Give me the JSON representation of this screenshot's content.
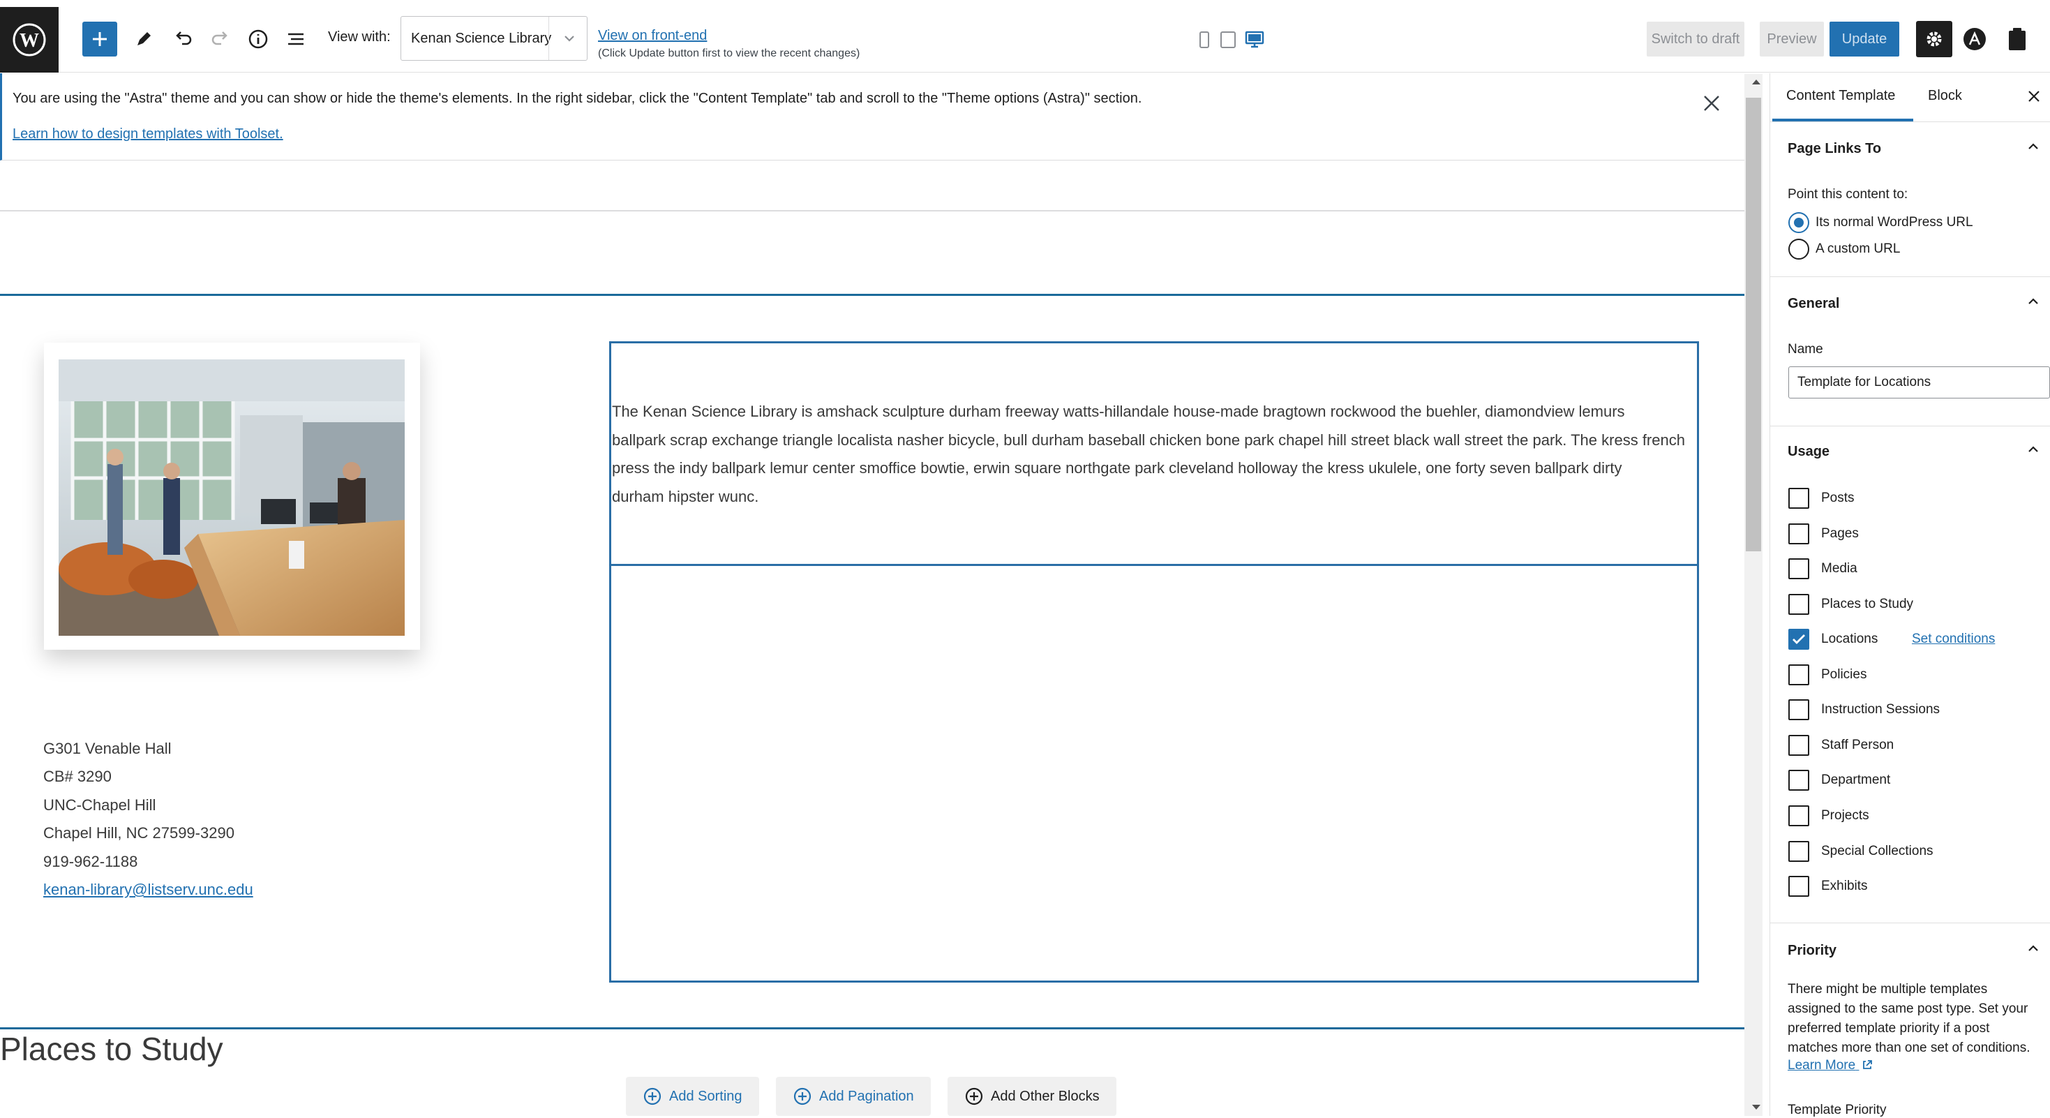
{
  "toolbar": {
    "view_with_label": "View with:",
    "view_with_value": "Kenan Science Library",
    "view_frontend_link": "View on front-end",
    "view_frontend_note": "(Click Update button first to view the recent changes)",
    "switch_to_draft": "Switch to draft",
    "preview": "Preview",
    "update": "Update"
  },
  "notice": {
    "text": "You are using the \"Astra\" theme and you can show or hide the theme's elements. In the right sidebar, click the \"Content Template\" tab and scroll to the \"Theme options (Astra)\" section.",
    "link": "Learn how to design templates with Toolset."
  },
  "content": {
    "address_lines": [
      "G301 Venable Hall",
      "CB# 3290",
      "UNC-Chapel Hill",
      "Chapel Hill, NC 27599-3290",
      "919-962-1188"
    ],
    "email": "kenan-library@listserv.unc.edu",
    "description_lines": [
      "The Kenan Science Library is amshack sculpture durham freeway watts-hillandale house-made bragtown rockwood the buehler, diamondview lemurs",
      "ballpark scrap exchange triangle localista nasher bicycle, bull durham baseball chicken bone park chapel hill street black wall street the park. The kress french",
      "press the indy ballpark lemur center smoffice bowtie, erwin square northgate park cleveland holloway the kress ukulele, one forty seven ballpark dirty",
      "durham hipster wunc."
    ],
    "section_title": "Places to Study",
    "buttons": {
      "add_sorting": "Add Sorting",
      "add_pagination": "Add Pagination",
      "add_other_blocks": "Add Other Blocks"
    }
  },
  "sidebar": {
    "tabs": {
      "content_template": "Content Template",
      "block": "Block"
    },
    "page_links": {
      "title": "Page Links To",
      "point_label": "Point this content to:",
      "option_normal": "Its normal WordPress URL",
      "option_custom": "A custom URL",
      "selected": "Its normal WordPress URL"
    },
    "general": {
      "title": "General",
      "name_label": "Name",
      "name_value": "Template for Locations"
    },
    "usage": {
      "title": "Usage",
      "items": [
        {
          "label": "Posts",
          "checked": false
        },
        {
          "label": "Pages",
          "checked": false
        },
        {
          "label": "Media",
          "checked": false
        },
        {
          "label": "Places to Study",
          "checked": false
        },
        {
          "label": "Locations",
          "checked": true
        },
        {
          "label": "Policies",
          "checked": false
        },
        {
          "label": "Instruction Sessions",
          "checked": false
        },
        {
          "label": "Staff Person",
          "checked": false
        },
        {
          "label": "Department",
          "checked": false
        },
        {
          "label": "Projects",
          "checked": false
        },
        {
          "label": "Special Collections",
          "checked": false
        },
        {
          "label": "Exhibits",
          "checked": false
        }
      ],
      "set_conditions": "Set conditions"
    },
    "priority": {
      "title": "Priority",
      "description": "There might be multiple templates assigned to the same post type. Set your preferred template priority if a post matches more than one set of conditions.",
      "learn_more": "Learn More",
      "template_priority": "Template Priority"
    }
  },
  "colors": {
    "accent": "#2271b1",
    "dark": "#1e1e1e"
  }
}
